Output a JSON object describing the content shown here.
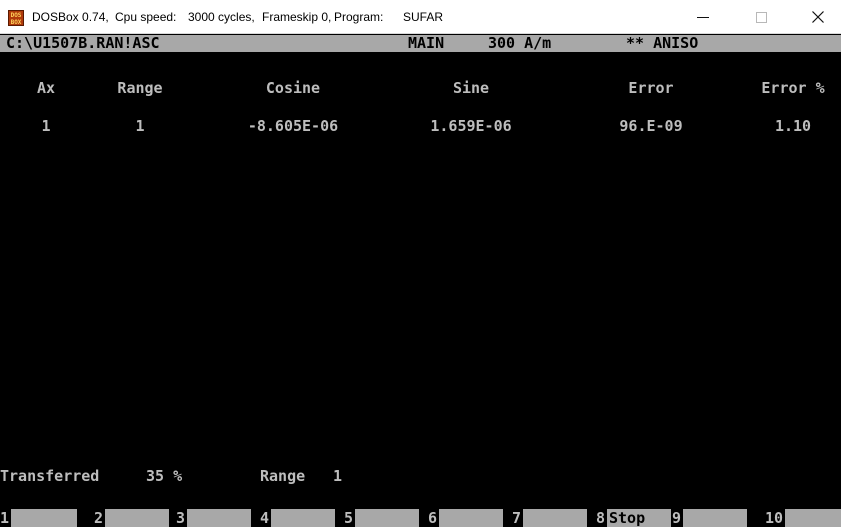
{
  "window": {
    "app": "DOSBox 0.74,",
    "cpu_label": "Cpu speed:",
    "cycles": "3000 cycles,",
    "frameskip": "Frameskip  0,",
    "program_label": "Program:",
    "program": "SUFAR",
    "minimize": "–",
    "maximize": "□",
    "close": "×"
  },
  "status": {
    "path": "C:\\U1507B.RAN!ASC",
    "mode": "MAIN",
    "field": "300 A/m",
    "aniso": "** ANISO"
  },
  "table": {
    "headers": [
      "Ax",
      "Range",
      "Cosine",
      "Sine",
      "Error",
      "Error %"
    ],
    "rows": [
      [
        "1",
        "1",
        "-8.605E-06",
        "1.659E-06",
        "96.E-09",
        "1.10"
      ]
    ]
  },
  "footer": {
    "transferred_label": "Transferred",
    "transferred_value": "35 %",
    "range_label": "Range",
    "range_value": "1"
  },
  "function_keys": [
    {
      "num": "1",
      "label": ""
    },
    {
      "num": "2",
      "label": ""
    },
    {
      "num": "3",
      "label": ""
    },
    {
      "num": "4",
      "label": ""
    },
    {
      "num": "5",
      "label": ""
    },
    {
      "num": "6",
      "label": ""
    },
    {
      "num": "7",
      "label": ""
    },
    {
      "num": "8",
      "label": "Stop"
    },
    {
      "num": "9",
      "label": ""
    },
    {
      "num": "10",
      "label": ""
    }
  ]
}
